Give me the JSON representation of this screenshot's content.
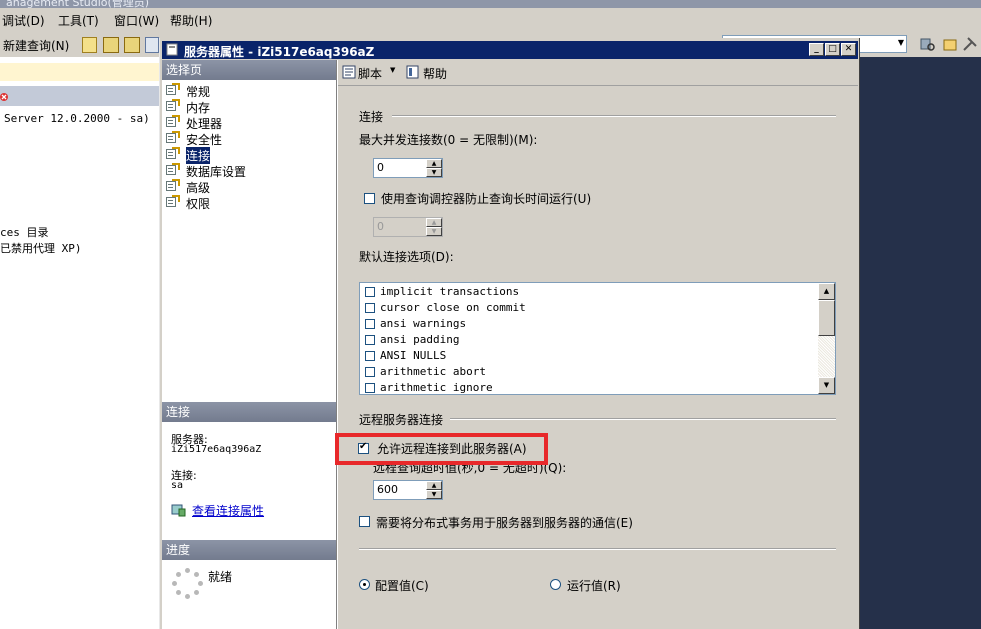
{
  "app": {
    "title_fragment": "anagement Studio(管理员)"
  },
  "menu": [
    "调试(D)",
    "工具(T)",
    "窗口(W)",
    "帮助(H)"
  ],
  "toolbar": {
    "new_query": "新建查询(N)"
  },
  "left_pane": {
    "server_line": "Server 12.0.2000 - sa)",
    "line2": "ces 目录",
    "line3": "已禁用代理 XP)"
  },
  "dialog": {
    "title": "服务器属性 - iZi517e6aq396aZ",
    "toolbar": {
      "script": "脚本",
      "help": "帮助"
    },
    "select_page": {
      "header": "选择页",
      "items": [
        "常规",
        "内存",
        "处理器",
        "安全性",
        "连接",
        "数据库设置",
        "高级",
        "权限"
      ],
      "selected": "连接"
    },
    "connection_panel": {
      "header": "连接",
      "server_label": "服务器:",
      "server_value": "iZi517e6aq396aZ",
      "conn_label": "连接:",
      "conn_value": "sa",
      "link": "查看连接属性"
    },
    "progress_panel": {
      "header": "进度",
      "status": "就绪"
    },
    "content": {
      "group_connections": "连接",
      "max_conn_label": "最大并发连接数(0 = 无限制)(M):",
      "max_conn_value": "0",
      "use_governor_label": "使用查询调控器防止查询长时间运行(U)",
      "use_governor_checked": false,
      "governor_value": "0",
      "default_options_label": "默认连接选项(D):",
      "default_options": [
        "implicit transactions",
        "cursor close on commit",
        "ansi warnings",
        "ansi padding",
        "ANSI NULLS",
        "arithmetic abort",
        "arithmetic ignore"
      ],
      "group_remote": "远程服务器连接",
      "allow_remote_label": "允许远程连接到此服务器(A)",
      "allow_remote_checked": true,
      "remote_timeout_label": "远程查询超时值(秒,0 = 无超时)(Q):",
      "remote_timeout_value": "600",
      "dist_tx_label": "需要将分布式事务用于服务器到服务器的通信(E)",
      "dist_tx_checked": false,
      "radio_config": "配置值(C)",
      "radio_running": "运行值(R)",
      "radio_selected": "config"
    }
  },
  "colors": {
    "title_bar": "#0a246a",
    "highlight_box": "#e8282a",
    "selected_nav": "#0a246a"
  }
}
